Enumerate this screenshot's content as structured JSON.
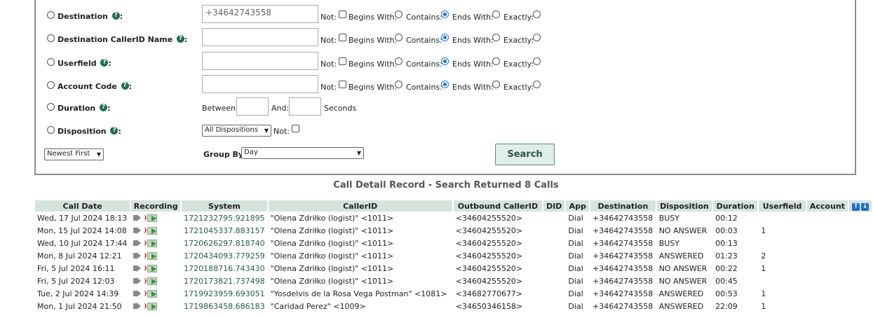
{
  "form": {
    "fields": [
      {
        "label": "Destination",
        "value": "+34642743558"
      },
      {
        "label": "Destination CallerID Name",
        "value": ""
      },
      {
        "label": "Userfield",
        "value": ""
      },
      {
        "label": "Account Code",
        "value": ""
      }
    ],
    "match": {
      "not": "Not:",
      "begins": "Begins With:",
      "contains": "Contains:",
      "ends": "Ends With:",
      "exactly": "Exactly:"
    },
    "duration": {
      "label": "Duration",
      "between": "Between:",
      "and": "And:",
      "seconds": "Seconds"
    },
    "disposition": {
      "label": "Disposition",
      "selected": "All Dispositions",
      "not": "Not:"
    },
    "order": {
      "selected": "Newest First"
    },
    "group_by": {
      "label": "Group By:",
      "selected": "Day"
    },
    "search_button": "Search",
    "help_glyph": "?"
  },
  "results": {
    "caption": "Call Detail Record - Search Returned 8 Calls",
    "columns": [
      "Call Date",
      "Recording",
      "System",
      "CallerID",
      "Outbound CallerID",
      "DID",
      "App",
      "Destination",
      "Disposition",
      "Duration",
      "Userfield",
      "Account"
    ],
    "rows": [
      {
        "date": "Wed, 17 Jul 2024 18:13",
        "system": "1721232795.921895",
        "callerid": "\"Olena Zdriłko (logist)\" <1011>",
        "outbound": "<34604255520>",
        "did": "",
        "app": "Dial",
        "dest": "+34642743558",
        "disp": "BUSY",
        "dur": "00:12",
        "userfield": "",
        "account": ""
      },
      {
        "date": "Mon, 15 Jul 2024 14:08",
        "system": "1721045337.883157",
        "callerid": "\"Olena Zdriłko (logist)\" <1011>",
        "outbound": "<34604255520>",
        "did": "",
        "app": "Dial",
        "dest": "+34642743558",
        "disp": "NO ANSWER",
        "dur": "00:03",
        "userfield": "1",
        "account": ""
      },
      {
        "date": "Wed, 10 Jul 2024 17:44",
        "system": "1720626297.818740",
        "callerid": "\"Olena Zdriłko (logist)\" <1011>",
        "outbound": "<34604255520>",
        "did": "",
        "app": "Dial",
        "dest": "+34642743558",
        "disp": "BUSY",
        "dur": "00:13",
        "userfield": "",
        "account": ""
      },
      {
        "date": "Mon, 8 Jul 2024 12:21",
        "system": "1720434093.779259",
        "callerid": "\"Olena Zdriłko (logist)\" <1011>",
        "outbound": "<34604255520>",
        "did": "",
        "app": "Dial",
        "dest": "+34642743558",
        "disp": "ANSWERED",
        "dur": "01:23",
        "userfield": "2",
        "account": ""
      },
      {
        "date": "Fri, 5 Jul 2024 16:11",
        "system": "1720188716.743430",
        "callerid": "\"Olena Zdriłko (logist)\" <1011>",
        "outbound": "<34604255520>",
        "did": "",
        "app": "Dial",
        "dest": "+34642743558",
        "disp": "NO ANSWER",
        "dur": "00:22",
        "userfield": "1",
        "account": ""
      },
      {
        "date": "Fri, 5 Jul 2024 12:03",
        "system": "1720173821.737498",
        "callerid": "\"Olena Zdriłko (logist)\" <1011>",
        "outbound": "<34604255520>",
        "did": "",
        "app": "Dial",
        "dest": "+34642743558",
        "disp": "NO ANSWER",
        "dur": "00:45",
        "userfield": "",
        "account": ""
      },
      {
        "date": "Tue, 2 Jul 2024 14:39",
        "system": "1719923959.693051",
        "callerid": "\"Yosdelvis de la Rosa Vega Postman\" <1081>",
        "outbound": "<34682770677>",
        "did": "",
        "app": "Dial",
        "dest": "+34642743558",
        "disp": "ANSWERED",
        "dur": "00:53",
        "userfield": "1",
        "account": ""
      },
      {
        "date": "Mon, 1 Jul 2024 21:50",
        "system": "1719863458.686183",
        "callerid": "\"Caridad Perez\" <1009>",
        "outbound": "<34650346158>",
        "did": "",
        "app": "Dial",
        "dest": "+34642743558",
        "disp": "ANSWERED",
        "dur": "22:09",
        "userfield": "1",
        "account": ""
      }
    ]
  },
  "icons": {
    "speaker": "speaker-icon",
    "download": "download-icon",
    "sort_up": "sort-ascending-icon",
    "sort_down": "sort-descending-icon"
  }
}
